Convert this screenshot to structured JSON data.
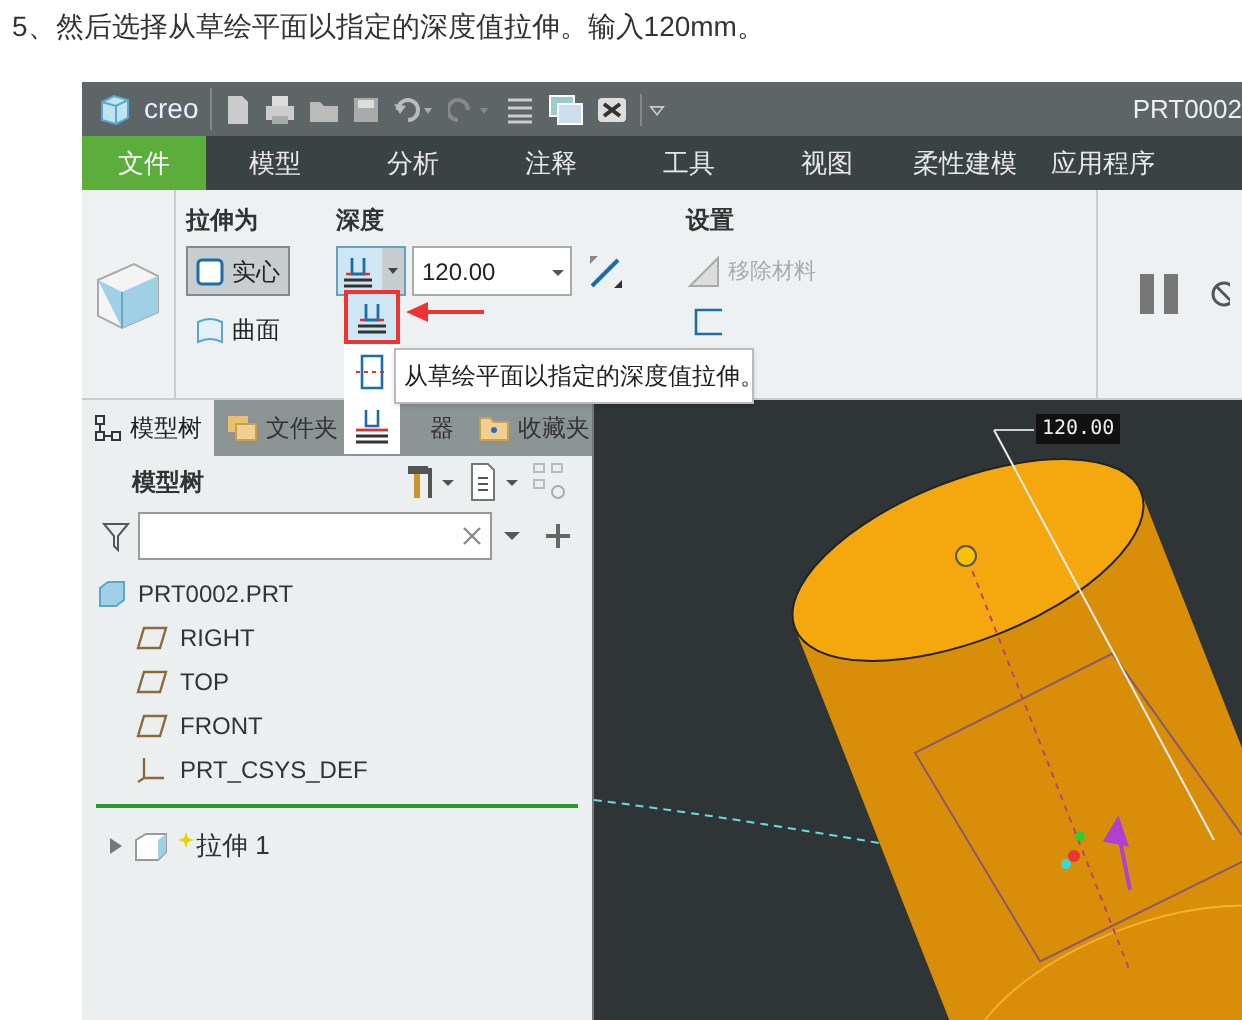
{
  "caption": "5、然后选择从草绘平面以指定的深度值拉伸。输入120mm。",
  "app": {
    "logo": "creo",
    "document_title": "PRT0002"
  },
  "menu_tabs": [
    {
      "label": "文件",
      "kind": "file"
    },
    {
      "label": "模型",
      "kind": "tab"
    },
    {
      "label": "分析",
      "kind": "tab"
    },
    {
      "label": "注释",
      "kind": "tab"
    },
    {
      "label": "工具",
      "kind": "tab"
    },
    {
      "label": "视图",
      "kind": "tab"
    },
    {
      "label": "柔性建模",
      "kind": "tab"
    },
    {
      "label": "应用程序",
      "kind": "tab"
    }
  ],
  "ribbon": {
    "extrude_as": {
      "title": "拉伸为",
      "options": [
        {
          "label": "实心",
          "selected": true
        },
        {
          "label": "曲面",
          "selected": false
        }
      ]
    },
    "depth": {
      "title": "深度",
      "value": "120.00"
    },
    "settings": {
      "title": "设置",
      "remove_material": {
        "label": "移除材料",
        "disabled": true
      }
    }
  },
  "depth_menu": {
    "tooltip": "从草绘平面以指定的深度值拉伸。"
  },
  "panel_tabs": [
    {
      "label": "模型树",
      "selected": true
    },
    {
      "label": "文件夹",
      "label_end": "器",
      "selected": false
    },
    {
      "label": "收藏夹",
      "selected": false
    }
  ],
  "model_tree": {
    "title": "模型树",
    "items": [
      {
        "label": "PRT0002.PRT",
        "kind": "part",
        "children": [
          {
            "label": "RIGHT",
            "kind": "plane"
          },
          {
            "label": "TOP",
            "kind": "plane"
          },
          {
            "label": "FRONT",
            "kind": "plane"
          },
          {
            "label": "PRT_CSYS_DEF",
            "kind": "csys"
          }
        ]
      }
    ],
    "features": [
      {
        "label": "拉伸 1",
        "kind": "feature",
        "expanded": false,
        "new": true
      }
    ]
  },
  "viewport": {
    "dimension": "120.00"
  }
}
